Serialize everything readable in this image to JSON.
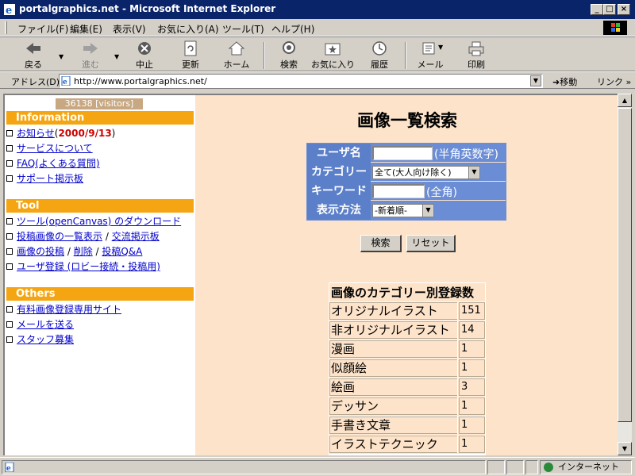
{
  "window": {
    "title": "portalgraphics.net - Microsoft Internet Explorer"
  },
  "menu": [
    "ファイル(F)",
    "編集(E)",
    "表示(V)",
    "お気に入り(A)",
    "ツール(T)",
    "ヘルプ(H)"
  ],
  "toolbar": {
    "back": "戻る",
    "forward": "進む",
    "stop": "中止",
    "refresh": "更新",
    "home": "ホーム",
    "search": "検索",
    "favorites": "お気に入り",
    "history": "履歴",
    "mail": "メール",
    "print": "印刷"
  },
  "address": {
    "label": "アドレス(D)",
    "url": "http://www.portalgraphics.net/",
    "go": "移動",
    "links": "リンク"
  },
  "sidebar": {
    "visitors": "36138 [visitors]",
    "sections": [
      {
        "title": "Information",
        "items": [
          {
            "label": "お知らせ",
            "suffix_open": "(",
            "date": "2000/9/13",
            "suffix_close": ")"
          },
          {
            "label": "サービスについて"
          },
          {
            "label": "FAQ(よくある質問)"
          },
          {
            "label": "サポート掲示板"
          }
        ]
      },
      {
        "title": "Tool",
        "items": [
          {
            "label": "ツール(openCanvas) のダウンロード"
          },
          {
            "label": "投稿画像の一覧表示",
            "sep": " / ",
            "label2": "交流掲示板"
          },
          {
            "label": "画像の投稿",
            "sep": " / ",
            "label2": "削除",
            "sep2": " / ",
            "label3": "投稿Q&A"
          },
          {
            "label": "ユーザ登録 (ロビー接続・投稿用)"
          }
        ]
      },
      {
        "title": "Others",
        "items": [
          {
            "label": "有料画像登録専用サイト"
          },
          {
            "label": "メールを送る"
          },
          {
            "label": "スタッフ募集"
          }
        ]
      }
    ]
  },
  "main": {
    "title": "画像一覧検索",
    "form": {
      "user_label": "ユーザ名",
      "user_hint": "(半角英数字)",
      "category_label": "カテゴリー",
      "category_value": "全て(大人向け除く)",
      "keyword_label": "キーワード",
      "keyword_hint": "(全角)",
      "display_label": "表示方法",
      "display_value": "-新着順-"
    },
    "search_button": "検索",
    "reset_button": "リセット",
    "category_table": {
      "header": "画像のカテゴリー別登録数",
      "rows": [
        {
          "name": "オリジナルイラスト",
          "count": "151"
        },
        {
          "name": "非オリジナルイラスト",
          "count": "14"
        },
        {
          "name": "漫画",
          "count": "1"
        },
        {
          "name": "似顔絵",
          "count": "1"
        },
        {
          "name": "絵画",
          "count": "3"
        },
        {
          "name": "デッサン",
          "count": "1"
        },
        {
          "name": "手書き文章",
          "count": "1"
        },
        {
          "name": "イラストテクニック",
          "count": "1"
        }
      ]
    }
  },
  "status": {
    "zone": "インターネット"
  },
  "colors": {
    "titlebar": "#0a246a",
    "section_head": "#f5a511",
    "form_blue": "#6b8dd6",
    "page_bg": "#fde3c9",
    "link": "#0000cc",
    "date_red": "#cc0000"
  }
}
